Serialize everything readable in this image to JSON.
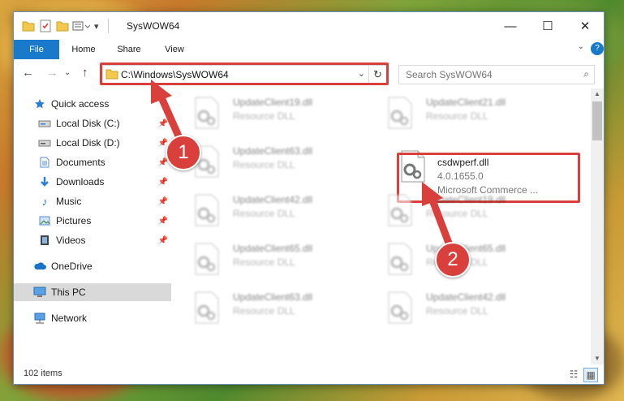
{
  "window": {
    "title": "SysWOW64"
  },
  "ribbon": {
    "tabs": [
      "File",
      "Home",
      "Share",
      "View"
    ],
    "help": "?"
  },
  "nav": {
    "address": "C:\\Windows\\SysWOW64",
    "search_placeholder": "Search SysWOW64"
  },
  "sidebar": {
    "items": [
      {
        "label": "Quick access"
      },
      {
        "label": "Local Disk (C:)"
      },
      {
        "label": "Local Disk (D:)"
      },
      {
        "label": "Documents"
      },
      {
        "label": "Downloads"
      },
      {
        "label": "Music"
      },
      {
        "label": "Pictures"
      },
      {
        "label": "Videos"
      },
      {
        "label": "OneDrive"
      },
      {
        "label": "This PC"
      },
      {
        "label": "Network"
      }
    ]
  },
  "files": {
    "left": [
      {
        "name": "UpdateClient19.dll",
        "type": "Resource DLL"
      },
      {
        "name": "UpdateClient63.dll",
        "type": "Resource DLL"
      },
      {
        "name": "UpdateClient42.dll",
        "type": "Resource DLL"
      },
      {
        "name": "UpdateClient65.dll",
        "type": "Resource DLL"
      },
      {
        "name": "UpdateClient63.dll",
        "type": "Resource DLL"
      }
    ],
    "right": [
      {
        "name": "UpdateClient21.dll",
        "type": "Resource DLL"
      },
      {
        "name": "UpdateClient19.dll",
        "type": "Resource DLL"
      },
      {
        "name": "UpdateClient65.dll",
        "type": "Resource DLL"
      },
      {
        "name": "UpdateClient42.dll",
        "type": "Resource DLL"
      }
    ],
    "highlighted": {
      "name": "csdwperf.dll",
      "version": "4.0.1655.0",
      "company": "Microsoft Commerce ..."
    }
  },
  "status": {
    "count": "102 items"
  },
  "callouts": {
    "one": "1",
    "two": "2"
  },
  "colors": {
    "accent": "#1979ca",
    "highlight": "#d9403b",
    "selected": "#d9d9d9"
  }
}
